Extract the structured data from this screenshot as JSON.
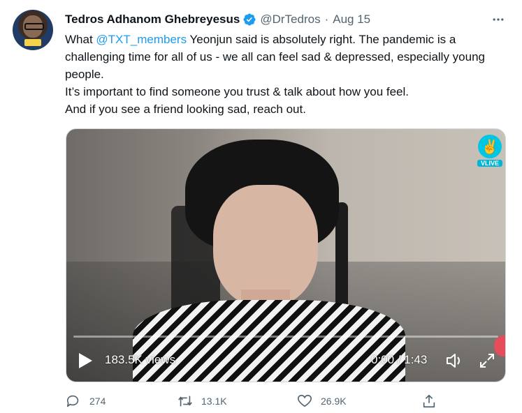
{
  "tweet": {
    "author_name": "Tedros Adhanom Ghebreyesus",
    "handle": "@DrTedros",
    "separator": "·",
    "date": "Aug 15",
    "text": {
      "line1_prefix": "What ",
      "mention": "@TXT_members",
      "line1_suffix": " Yeonjun said is absolutely right. The pandemic is a challenging time for all of us - we all can feel sad & depressed, especially young people.",
      "line2": "It’s important to find someone you trust & talk about how you feel.",
      "line3": "And if you see a friend looking sad, reach out."
    }
  },
  "video": {
    "views": "183.5K views",
    "time": "0:00 / 1:43",
    "watermark": "VLIVE",
    "progress": 0.0
  },
  "actions": {
    "replies": "274",
    "retweets": "13.1K",
    "likes": "26.9K"
  },
  "colors": {
    "accent": "#1d9bf0",
    "muted": "#536471",
    "text": "#0f1419"
  },
  "icons": [
    "verified-badge-icon",
    "more-icon",
    "play-icon",
    "volume-icon",
    "fullscreen-icon",
    "reply-icon",
    "retweet-icon",
    "like-icon",
    "share-icon"
  ]
}
